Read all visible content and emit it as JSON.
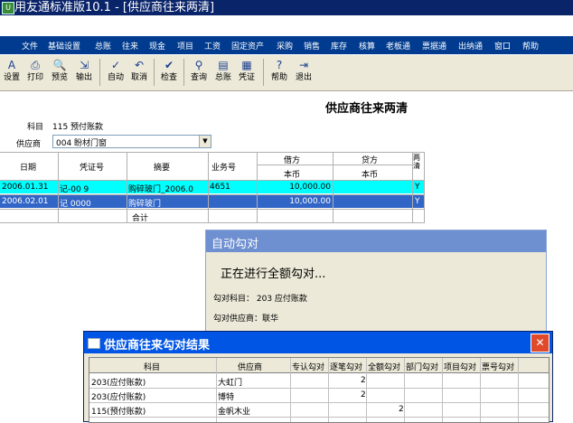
{
  "window": {
    "title": "用友通标准版10.1 - [供应商往来两清]"
  },
  "menu": [
    "文件",
    "基础设置",
    "总账",
    "往来",
    "现金",
    "项目",
    "工资",
    "固定资产",
    "采购",
    "销售",
    "库存",
    "核算",
    "老板通",
    "票据通",
    "出纳通",
    "窗口",
    "帮助"
  ],
  "toolbar": [
    {
      "icon": "settings-icon",
      "glyph": "A",
      "label": "设置"
    },
    {
      "icon": "print-icon",
      "glyph": "⎙",
      "label": "打印"
    },
    {
      "icon": "preview-icon",
      "glyph": "🔍",
      "label": "预览"
    },
    {
      "icon": "export-icon",
      "glyph": "⇲",
      "label": "输出"
    },
    {
      "icon": "auto-icon",
      "glyph": "✓",
      "label": "自动"
    },
    {
      "icon": "undo-icon",
      "glyph": "↶",
      "label": "取消"
    },
    {
      "icon": "check-icon",
      "glyph": "✔",
      "label": "检查"
    },
    {
      "icon": "query-icon",
      "glyph": "⚲",
      "label": "查询"
    },
    {
      "icon": "ledger-icon",
      "glyph": "▤",
      "label": "总账"
    },
    {
      "icon": "voucher-icon",
      "glyph": "▦",
      "label": "凭证"
    },
    {
      "icon": "help-icon",
      "glyph": "?",
      "label": "帮助"
    },
    {
      "icon": "exit-icon",
      "glyph": "⇥",
      "label": "退出"
    }
  ],
  "page": {
    "title": "供应商往来两清",
    "subject_label": "科目",
    "subject_value": "115 预付账款",
    "supplier_label": "供应商",
    "supplier_value": "004 盼材门窗"
  },
  "ledger": {
    "headers": {
      "date": "日期",
      "voucher_no": "凭证号",
      "summary": "摘要",
      "business_no": "业务号",
      "debit": "借方",
      "debit_sub": "本币",
      "credit": "贷方",
      "credit_sub": "本币",
      "clear": "两清"
    },
    "rows": [
      {
        "date": "2006.01.31",
        "voucher_no": "记-00 9",
        "summary": "购碎玻门_2006.0",
        "business_no": "4651",
        "debit": "10,000.00",
        "credit": "",
        "clear": "Y",
        "style": "cyan"
      },
      {
        "date": "2006.02.01",
        "voucher_no": "记 0000",
        "summary": "购碎玻门",
        "business_no": "",
        "debit": "10,000.00",
        "credit": "",
        "clear": "Y",
        "style": "selected"
      },
      {
        "date": "",
        "voucher_no": "",
        "summary": "合计",
        "business_no": "",
        "debit": "",
        "credit": "",
        "clear": "",
        "style": "plain"
      }
    ]
  },
  "auto_dialog": {
    "title": "自动勾对",
    "progress": "正在进行全额勾对...",
    "subject": "勾对科目： 203 应付账款",
    "supplier": "勾对供应商：联华"
  },
  "result_dialog": {
    "title": "供应商往来勾对结果",
    "close": "✕",
    "columns": [
      "科目",
      "供应商",
      "专认勾对",
      "逐笔勾对",
      "全额勾对",
      "部门勾对",
      "项目勾对",
      "票号勾对"
    ],
    "rows": [
      {
        "subject": "203(应付账款)",
        "supplier": "大虹门",
        "c1": "",
        "c2": "2",
        "c3": "",
        "c4": "",
        "c5": "",
        "c6": ""
      },
      {
        "subject": "203(应付账款)",
        "supplier": "博特",
        "c1": "",
        "c2": "2",
        "c3": "",
        "c4": "",
        "c5": "",
        "c6": ""
      },
      {
        "subject": "115(预付账款)",
        "supplier": "金帆木业",
        "c1": "",
        "c2": "",
        "c3": "2",
        "c4": "",
        "c5": "",
        "c6": ""
      }
    ]
  },
  "colors": {
    "titlebar": "#0a246a",
    "menubar": "#003b8f",
    "row_cyan": "#00ffff",
    "row_selected": "#3165c6",
    "dialog_header": "#0055e5"
  }
}
